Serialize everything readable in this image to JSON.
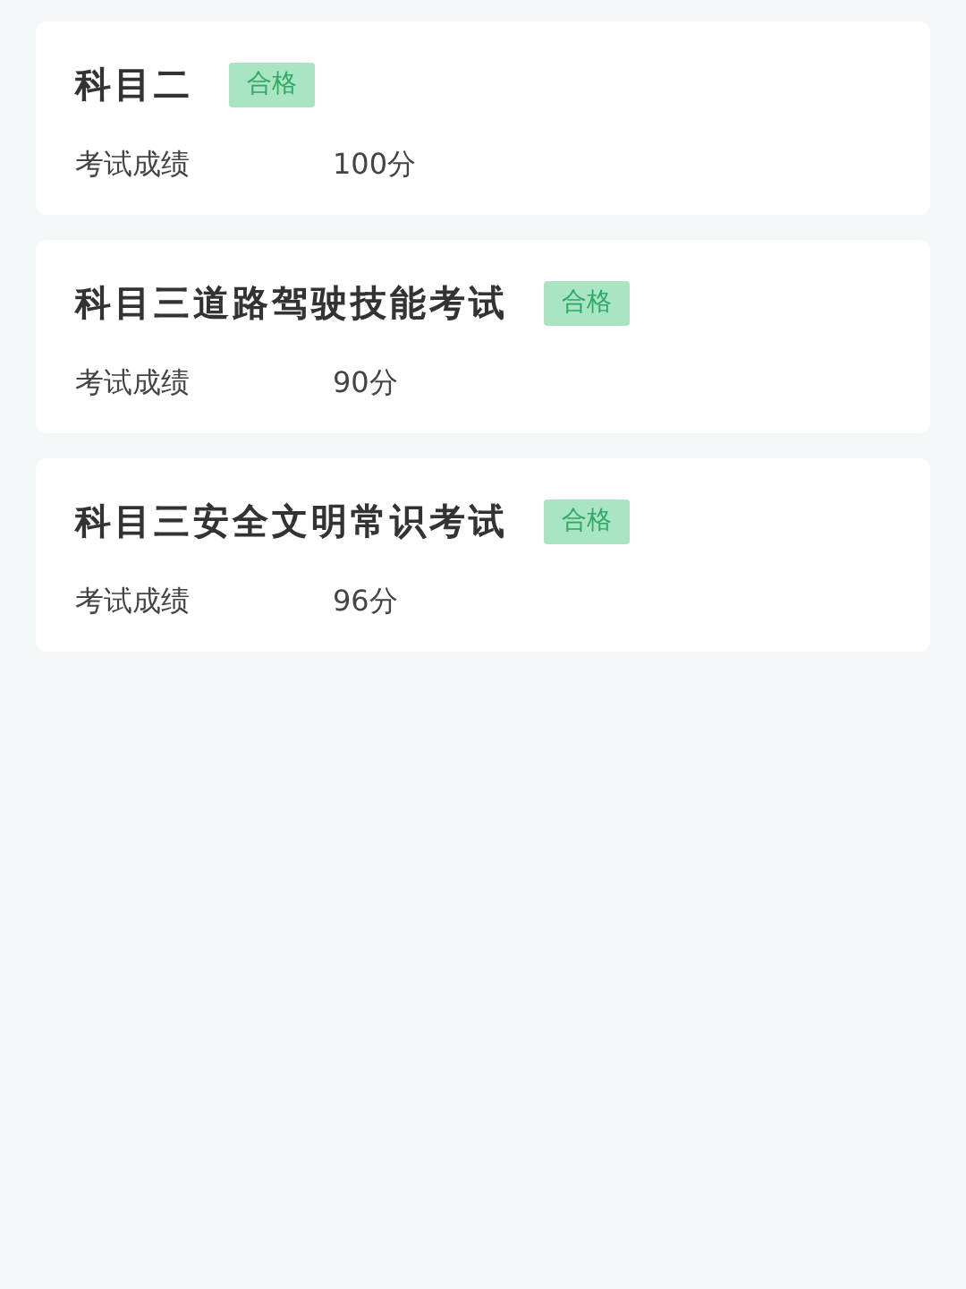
{
  "exams": [
    {
      "title": "科目二",
      "status": {
        "label": "合格",
        "kind": "pass"
      },
      "score_label": "考试成绩",
      "score": "100分"
    },
    {
      "title": "科目三道路驾驶技能考试",
      "status": {
        "label": "合格",
        "kind": "pass"
      },
      "score_label": "考试成绩",
      "score": "90分"
    },
    {
      "title": "科目三安全文明常识考试",
      "status": {
        "label": "合格",
        "kind": "pass"
      },
      "score_label": "考试成绩",
      "score": "96分"
    }
  ]
}
